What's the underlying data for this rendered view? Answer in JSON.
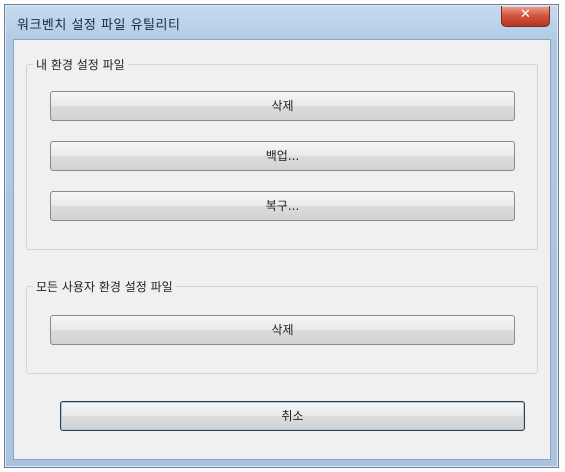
{
  "window": {
    "title": "워크벤치 설정 파일 유틸리티",
    "close_glyph": "✕"
  },
  "group_my_settings": {
    "label": "내 환경 설정 파일",
    "delete_label": "삭제",
    "backup_label": "백업...",
    "restore_label": "복구..."
  },
  "group_all_users": {
    "label": "모든 사용자 환경 설정 파일",
    "delete_label": "삭제"
  },
  "cancel_label": "취소"
}
